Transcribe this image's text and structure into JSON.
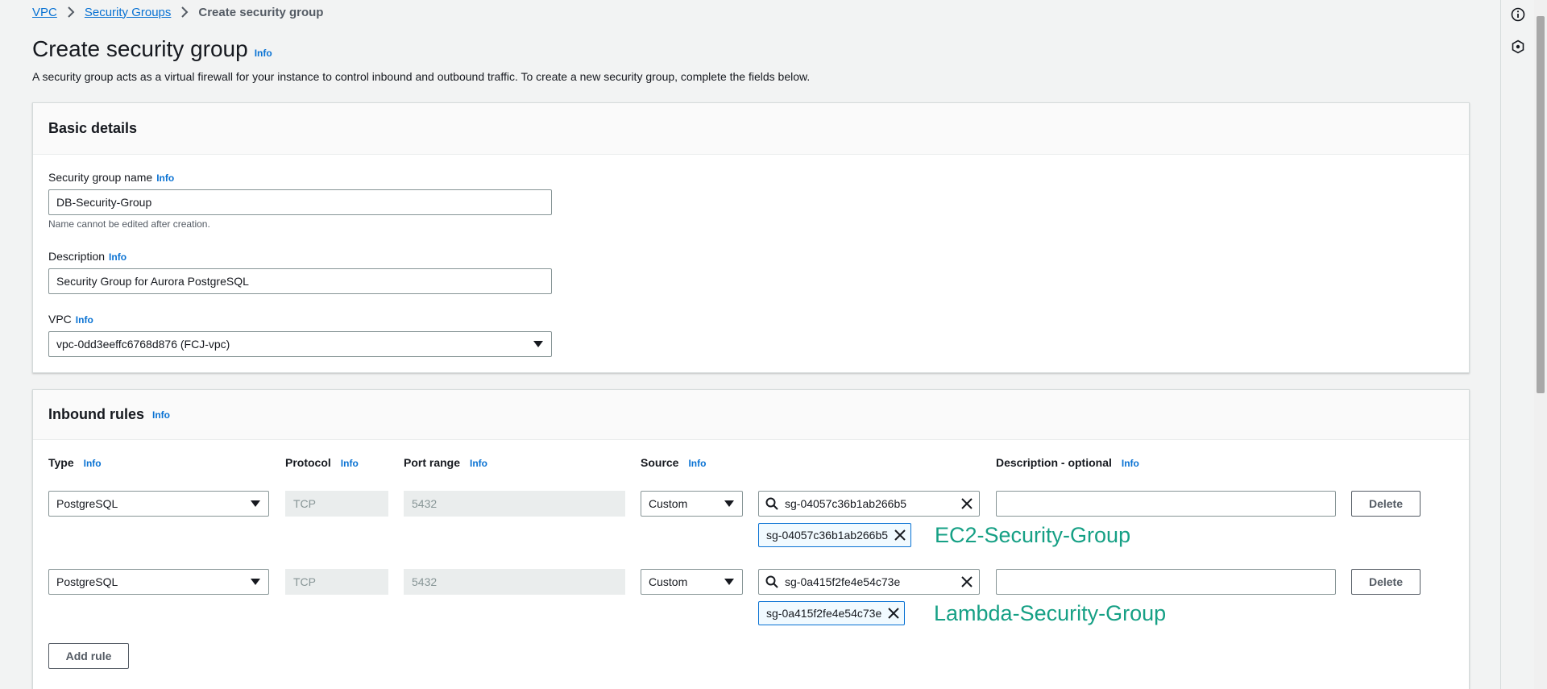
{
  "breadcrumb": {
    "items": [
      "VPC",
      "Security Groups"
    ],
    "current": "Create security group"
  },
  "header": {
    "title": "Create security group",
    "info": "Info",
    "description": "A security group acts as a virtual firewall for your instance to control inbound and outbound traffic. To create a new security group, complete the fields below."
  },
  "basic": {
    "title": "Basic details",
    "name_label": "Security group name",
    "name_value": "DB-Security-Group",
    "name_hint": "Name cannot be edited after creation.",
    "desc_label": "Description",
    "desc_value": "Security Group for Aurora PostgreSQL",
    "vpc_label": "VPC",
    "vpc_value": "vpc-0dd3eeffc6768d876 (FCJ-vpc)",
    "info": "Info"
  },
  "inbound": {
    "title": "Inbound rules",
    "info": "Info",
    "columns": {
      "type": "Type",
      "protocol": "Protocol",
      "port_range": "Port range",
      "source": "Source",
      "description": "Description - optional"
    },
    "rules": [
      {
        "type": "PostgreSQL",
        "protocol": "TCP",
        "port": "5432",
        "source": "Custom",
        "search_value": "sg-04057c36b1ab266b5",
        "token": "sg-04057c36b1ab266b5",
        "annotation": "EC2-Security-Group",
        "description": "",
        "delete_label": "Delete"
      },
      {
        "type": "PostgreSQL",
        "protocol": "TCP",
        "port": "5432",
        "source": "Custom",
        "search_value": "sg-0a415f2fe4e54c73e",
        "token": "sg-0a415f2fe4e54c73e",
        "annotation": "Lambda-Security-Group",
        "description": "",
        "delete_label": "Delete"
      }
    ],
    "add_rule_label": "Add rule"
  },
  "icons": {
    "chevron": "chevron-right-icon",
    "caret": "caret-down-icon",
    "search": "search-icon",
    "close": "close-icon",
    "info_rail": "info-circle-icon",
    "rail_second": "hexagon-icon"
  },
  "colors": {
    "link": "#0972d3",
    "annotation": "#16a085",
    "background": "#f2f3f3"
  }
}
